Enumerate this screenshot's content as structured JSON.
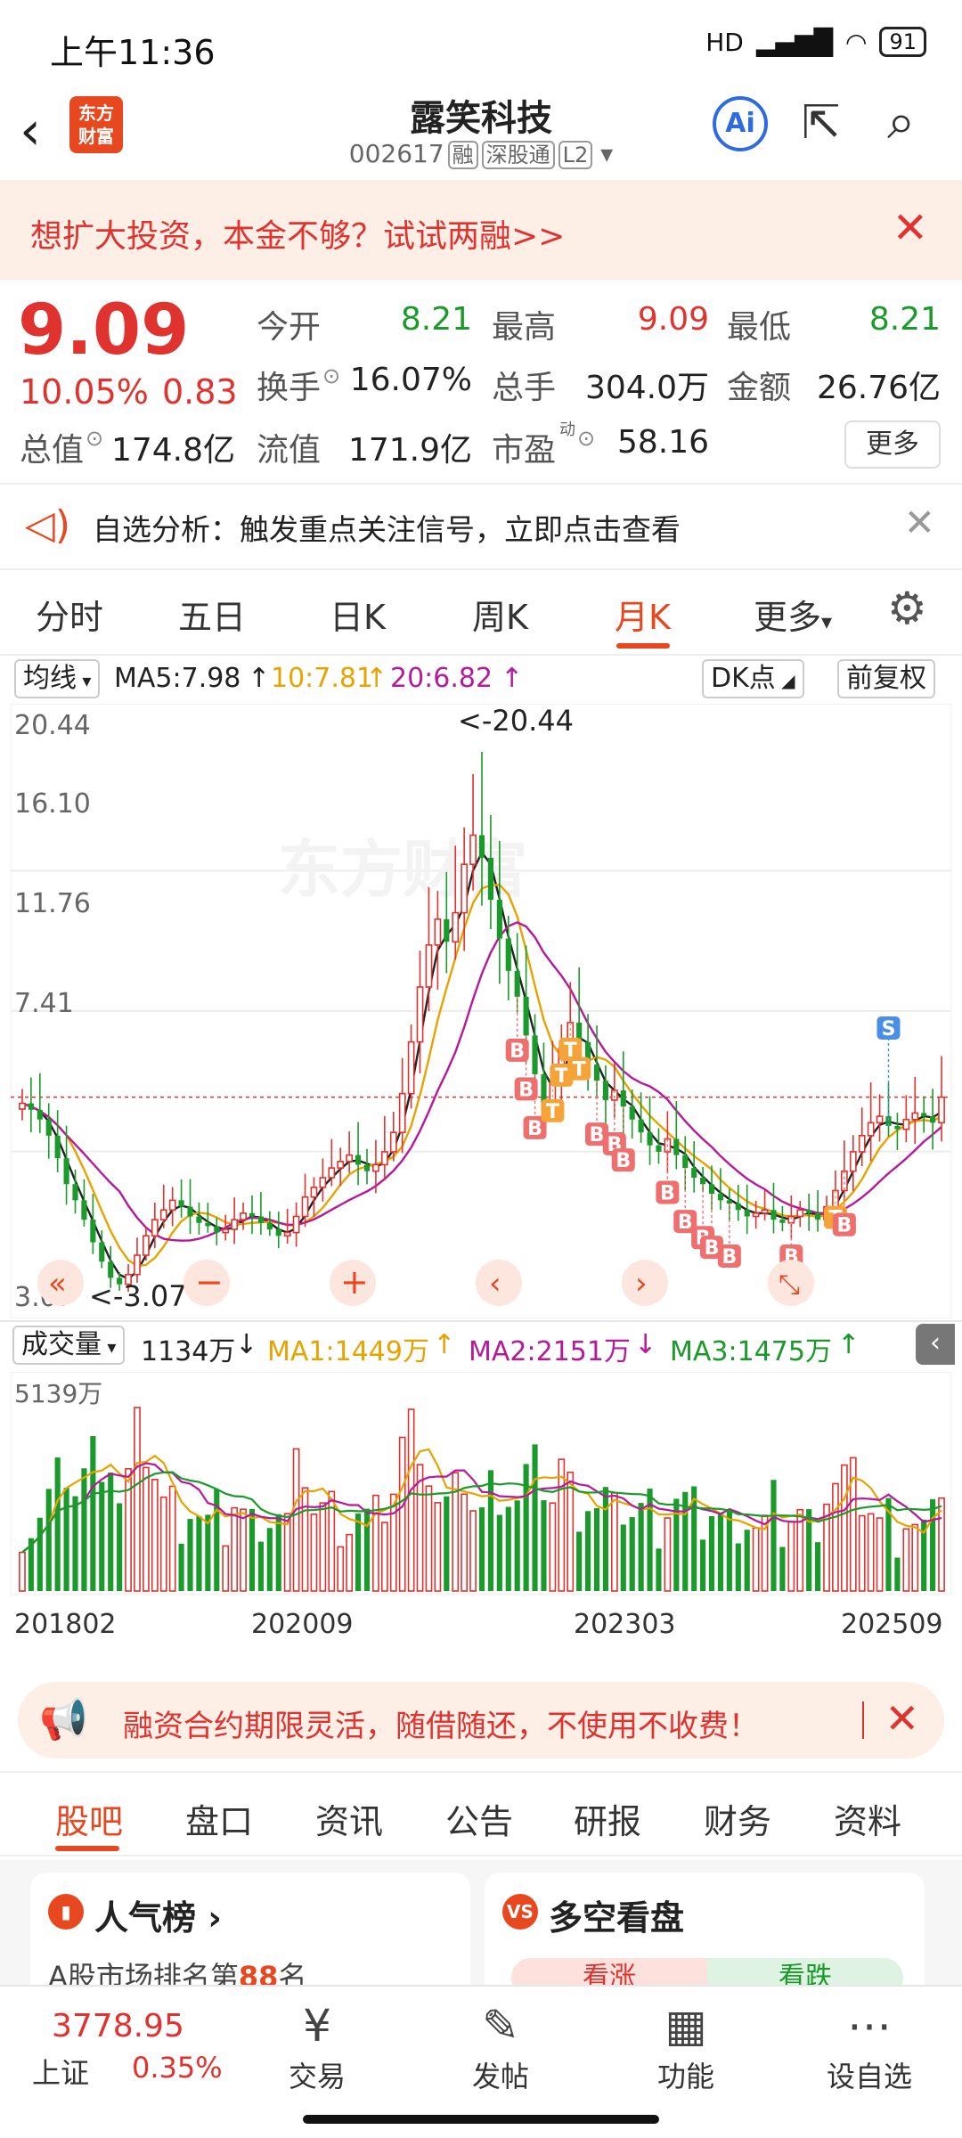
{
  "status": {
    "time": "上午11:36",
    "battery": "91",
    "signal": "HD"
  },
  "header": {
    "logo_l1": "东方",
    "logo_l2": "财富",
    "title": "露笑科技",
    "code": "002617",
    "tags": [
      "融",
      "深股通",
      "L2"
    ],
    "ai_label": "Ai"
  },
  "banner": {
    "text": "想扩大投资，本金不够？试试两融>>"
  },
  "quote": {
    "price": "9.09",
    "change_pct": "10.05%",
    "change": "0.83",
    "open_label": "今开",
    "open": "8.21",
    "high_label": "最高",
    "high": "9.09",
    "low_label": "最低",
    "low": "8.21",
    "turnover_label": "换手",
    "turnover": "16.07%",
    "volume_label": "总手",
    "volume": "304.0万",
    "amount_label": "金额",
    "amount": "26.76亿",
    "mcap_label": "总值",
    "mcap": "174.8亿",
    "float_label": "流值",
    "float": "171.9亿",
    "pe_label": "市盈",
    "pe_sup": "动",
    "pe": "58.16",
    "more": "更多"
  },
  "alert": {
    "text": "自选分析：触发重点关注信号，立即点击查看"
  },
  "ktabs": {
    "items": [
      "分时",
      "五日",
      "日K",
      "周K",
      "月K",
      "更多"
    ],
    "active": "月K"
  },
  "ma": {
    "select": "均线",
    "ma5": "MA5:7.98",
    "ma10": "10:7.81",
    "ma20": "20:6.82",
    "dk": "DK点",
    "fq": "前复权"
  },
  "kchart": {
    "y_labels": [
      "20.44",
      "16.10",
      "11.76",
      "7.41",
      "3.07"
    ],
    "max_label": "<-20.44",
    "min_label": "<-3.07"
  },
  "vol": {
    "select": "成交量",
    "vol": "1134万",
    "ma1": "MA1:1449万",
    "ma2": "MA2:2151万",
    "ma3": "MA3:1475万",
    "max_label": "5139万"
  },
  "chart_data": {
    "type": "bar",
    "title": "",
    "xlabel": "",
    "ylabel": "",
    "x_ticks": [
      "201802",
      "202009",
      "202303",
      "202509"
    ],
    "ylim": [
      3.07,
      20.44
    ],
    "last_close": 9.09,
    "close": [
      8.9,
      8.7,
      8.4,
      7.9,
      7.2,
      6.4,
      5.9,
      5.3,
      4.6,
      4.0,
      3.5,
      3.3,
      3.6,
      4.2,
      4.8,
      5.3,
      5.6,
      5.9,
      5.7,
      5.4,
      5.2,
      5.1,
      4.9,
      5.0,
      5.3,
      5.5,
      5.4,
      5.2,
      5.0,
      4.8,
      4.9,
      5.4,
      6.0,
      6.3,
      6.6,
      6.9,
      7.1,
      7.3,
      7.0,
      6.8,
      7.0,
      7.4,
      8.0,
      9.2,
      10.8,
      12.5,
      13.8,
      14.6,
      13.9,
      14.8,
      16.3,
      17.2,
      16.5,
      15.2,
      14.0,
      13.0,
      12.2,
      11.0,
      9.8,
      8.9,
      9.5,
      10.6,
      11.4,
      10.8,
      10.1,
      9.6,
      9.0,
      9.3,
      8.8,
      8.4,
      8.0,
      7.6,
      7.4,
      7.8,
      7.3,
      6.9,
      6.6,
      6.4,
      6.1,
      5.9,
      5.8,
      5.6,
      5.4,
      5.5,
      5.6,
      5.3,
      5.2,
      5.4,
      5.6,
      5.5,
      5.3,
      5.7,
      6.2,
      6.8,
      7.4,
      7.9,
      8.3,
      8.5,
      8.2,
      8.1,
      8.4,
      8.6,
      8.5,
      8.3,
      9.09
    ]
  }
}
